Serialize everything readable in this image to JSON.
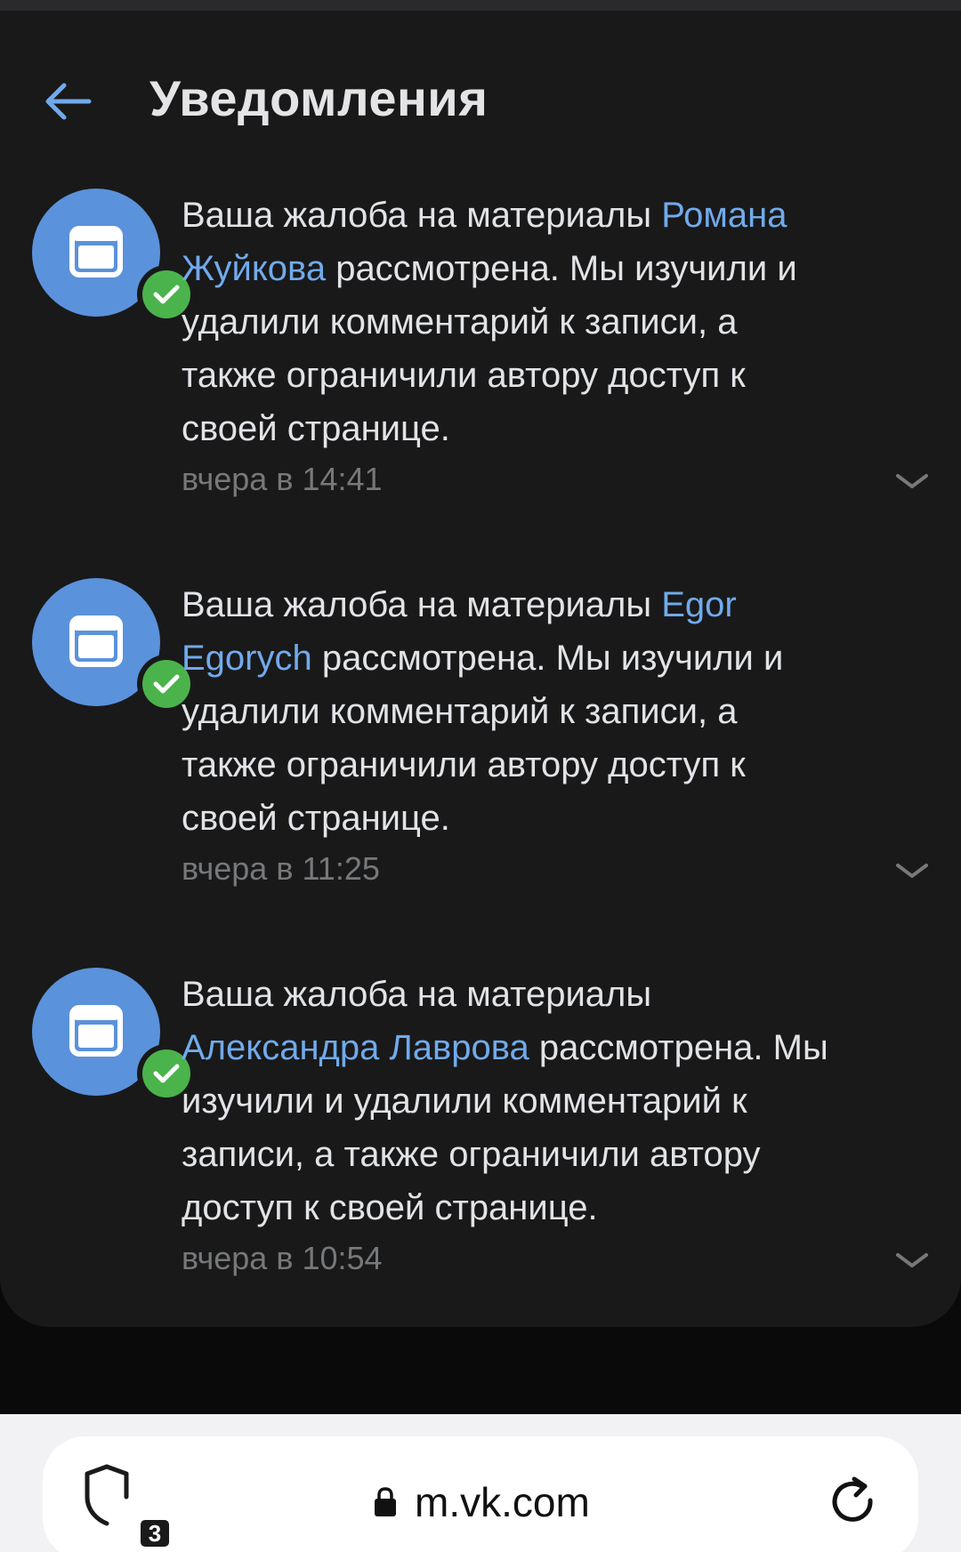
{
  "header": {
    "title": "Уведомления"
  },
  "colors": {
    "accent": "#71aaeb",
    "avatar": "#5b92dc",
    "success": "#4bb34b",
    "panel_bg": "#19191a",
    "text_primary": "#e1e3e6",
    "text_secondary": "#76787a"
  },
  "notifications": [
    {
      "icon": "window-icon",
      "badge": "check-icon",
      "lines": [
        [
          {
            "text": "Ваша жалоба на материалы "
          },
          {
            "text": "Романа",
            "link": true
          }
        ],
        [
          {
            "text": "Жуйкова",
            "link": true
          },
          {
            "text": " рассмотрена. Мы изучили и"
          }
        ],
        [
          {
            "text": "удалили комментарий к записи, а"
          }
        ],
        [
          {
            "text": "также ограничили автору доступ к"
          }
        ],
        [
          {
            "text": "своей странице."
          }
        ]
      ],
      "time": "вчера в 14:41"
    },
    {
      "icon": "window-icon",
      "badge": "check-icon",
      "lines": [
        [
          {
            "text": "Ваша жалоба на материалы "
          },
          {
            "text": "Egor",
            "link": true
          }
        ],
        [
          {
            "text": "Egorych",
            "link": true
          },
          {
            "text": " рассмотрена. Мы изучили и"
          }
        ],
        [
          {
            "text": "удалили комментарий к записи, а"
          }
        ],
        [
          {
            "text": "также ограничили автору доступ к"
          }
        ],
        [
          {
            "text": "своей странице."
          }
        ]
      ],
      "time": "вчера в 11:25"
    },
    {
      "icon": "window-icon",
      "badge": "check-icon",
      "lines": [
        [
          {
            "text": "Ваша жалоба на материалы"
          }
        ],
        [
          {
            "text": "Александра Лаврова",
            "link": true
          },
          {
            "text": " рассмотрена. Мы"
          }
        ],
        [
          {
            "text": "изучили и удалили комментарий к"
          }
        ],
        [
          {
            "text": "записи, а также ограничили автору"
          }
        ],
        [
          {
            "text": "доступ к своей странице."
          }
        ]
      ],
      "time": "вчера в 10:54"
    }
  ],
  "browser": {
    "tab_count": "3",
    "url": "m.vk.com",
    "shield_icon": "shield-icon",
    "lock_icon": "lock-icon",
    "reload_icon": "reload-icon"
  }
}
